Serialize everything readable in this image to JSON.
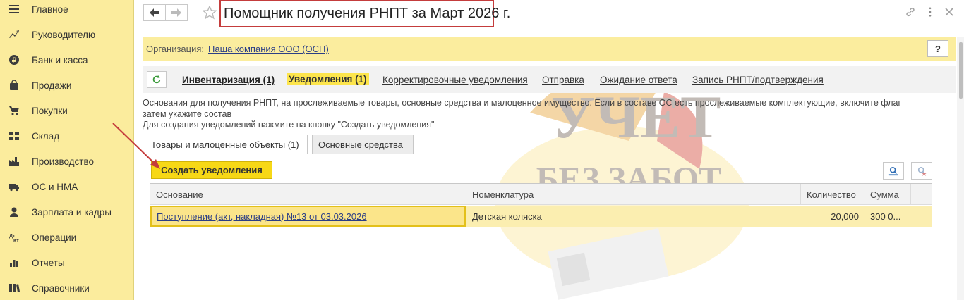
{
  "sidebar": {
    "items": [
      {
        "label": "Главное",
        "icon": "menu-icon"
      },
      {
        "label": "Руководителю",
        "icon": "trend-icon"
      },
      {
        "label": "Банк и касса",
        "icon": "ruble-coin-icon"
      },
      {
        "label": "Продажи",
        "icon": "shopping-bag-icon"
      },
      {
        "label": "Покупки",
        "icon": "cart-icon"
      },
      {
        "label": "Склад",
        "icon": "warehouse-icon"
      },
      {
        "label": "Производство",
        "icon": "factory-icon"
      },
      {
        "label": "ОС и НМА",
        "icon": "truck-icon"
      },
      {
        "label": "Зарплата и кадры",
        "icon": "person-icon"
      },
      {
        "label": "Операции",
        "icon": "dt-kt-icon"
      },
      {
        "label": "Отчеты",
        "icon": "bar-chart-icon"
      },
      {
        "label": "Справочники",
        "icon": "books-icon"
      }
    ]
  },
  "header": {
    "title": "Помощник получения РНПТ за Март 2026 г."
  },
  "org": {
    "label": "Организация:",
    "value": "Наша компания ООО (ОСН)",
    "help_label": "?"
  },
  "tabs": [
    {
      "label": "Инвентаризация (1)"
    },
    {
      "label": "Уведомления (1)"
    },
    {
      "label": "Корректировочные уведомления"
    },
    {
      "label": "Отправка"
    },
    {
      "label": "Ожидание ответа"
    },
    {
      "label": "Запись РНПТ/подтверждения"
    }
  ],
  "info": {
    "line1": "Основания для получения РНПТ, на прослеживаемые товары, основные средства и малоценное имущество. Если в составе ОС есть прослеживаемые комплектующие, включите флаг",
    "line2": "затем укажите состав",
    "line3": "Для создания уведомлений нажмите на кнопку \"Создать уведомления\""
  },
  "subtabs": [
    {
      "label": "Товары и малоценные объекты (1)"
    },
    {
      "label": "Основные средства"
    }
  ],
  "actions": {
    "create_label": "Создать уведомления"
  },
  "table": {
    "columns": [
      "Основание",
      "Номенклатура",
      "Количество",
      "Сумма"
    ],
    "rows": [
      {
        "basis": "Поступление (акт, накладная) №13 от 03.03.2026",
        "nomenclature": "Детская коляска",
        "quantity": "20,000",
        "sum": "300 0..."
      }
    ]
  },
  "watermark": {
    "line1": "УЧЕТ",
    "line2": "БЕЗ ЗАБОТ"
  },
  "colors": {
    "sidebar_bg": "#fbec9d",
    "accent_yellow": "#f7d816",
    "highlight_row": "#fbeeb0",
    "link_blue": "#2b3e86",
    "annotation_red": "#c43c3c"
  }
}
